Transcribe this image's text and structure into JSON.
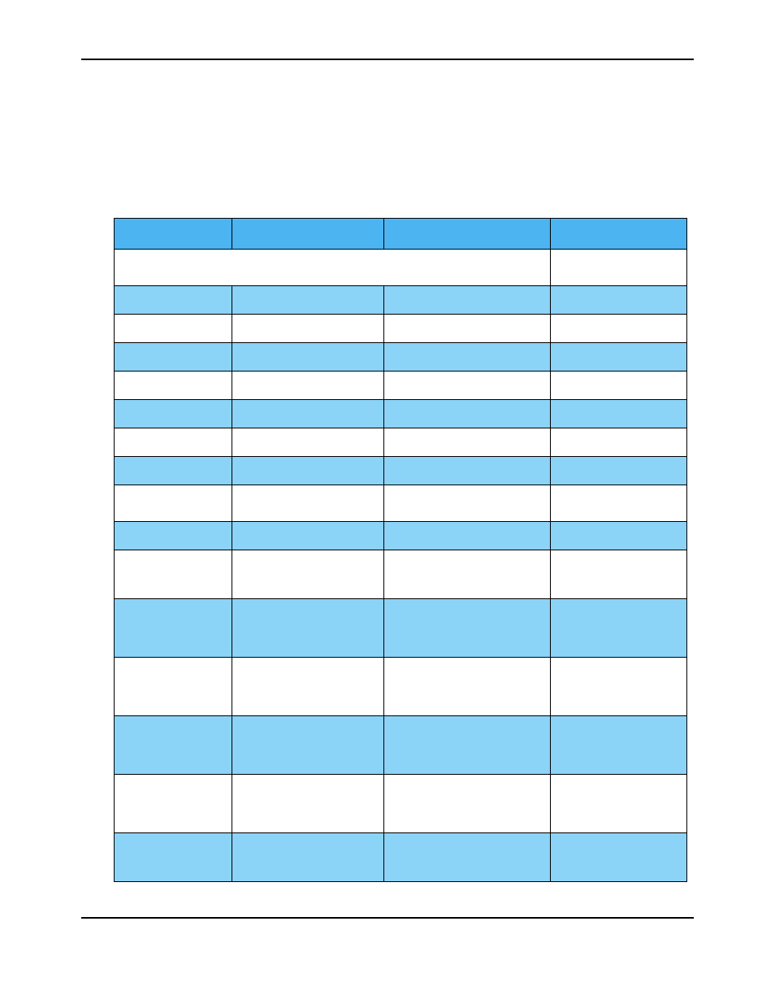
{
  "colors": {
    "header_bg": "#4BB4F1",
    "stripe_bg": "#8BD3F7",
    "blank_bg": "#ffffff",
    "border": "#000000"
  },
  "table": {
    "headers": [
      "",
      "",
      "",
      ""
    ],
    "rows": [
      {
        "type": "merged",
        "span": 3,
        "height": "h-m",
        "left_bg": "bg-white",
        "right_bg": "bg-white",
        "cells": [
          "",
          ""
        ]
      },
      {
        "type": "normal",
        "height": "h-s",
        "bg": "bg-light",
        "cells": [
          "",
          "",
          "",
          ""
        ]
      },
      {
        "type": "normal",
        "height": "h-s",
        "bg": "bg-white",
        "cells": [
          "",
          "",
          "",
          ""
        ]
      },
      {
        "type": "normal",
        "height": "h-s",
        "bg": "bg-light",
        "cells": [
          "",
          "",
          "",
          ""
        ]
      },
      {
        "type": "normal",
        "height": "h-s",
        "bg": "bg-white",
        "cells": [
          "",
          "",
          "",
          ""
        ]
      },
      {
        "type": "normal",
        "height": "h-s",
        "bg": "bg-light",
        "cells": [
          "",
          "",
          "",
          ""
        ]
      },
      {
        "type": "normal",
        "height": "h-s",
        "bg": "bg-white",
        "cells": [
          "",
          "",
          "",
          ""
        ]
      },
      {
        "type": "normal",
        "height": "h-s",
        "bg": "bg-light",
        "cells": [
          "",
          "",
          "",
          ""
        ]
      },
      {
        "type": "normal",
        "height": "h-m",
        "bg": "bg-white",
        "cells": [
          "",
          "",
          "",
          ""
        ]
      },
      {
        "type": "normal",
        "height": "h-s",
        "bg": "bg-light",
        "cells": [
          "",
          "",
          "",
          ""
        ]
      },
      {
        "type": "normal",
        "height": "h-l",
        "bg": "bg-white",
        "cells": [
          "",
          "",
          "",
          ""
        ]
      },
      {
        "type": "normal",
        "height": "h-xl",
        "bg": "bg-light",
        "cells": [
          "",
          "",
          "",
          ""
        ]
      },
      {
        "type": "normal",
        "height": "h-xl",
        "bg": "bg-white",
        "cells": [
          "",
          "",
          "",
          ""
        ]
      },
      {
        "type": "normal",
        "height": "h-xl",
        "bg": "bg-light",
        "cells": [
          "",
          "",
          "",
          ""
        ]
      },
      {
        "type": "normal",
        "height": "h-xl",
        "bg": "bg-white",
        "cells": [
          "",
          "",
          "",
          ""
        ]
      },
      {
        "type": "normal",
        "height": "h-l",
        "bg": "bg-light",
        "cells": [
          "",
          "",
          "",
          ""
        ]
      }
    ]
  }
}
